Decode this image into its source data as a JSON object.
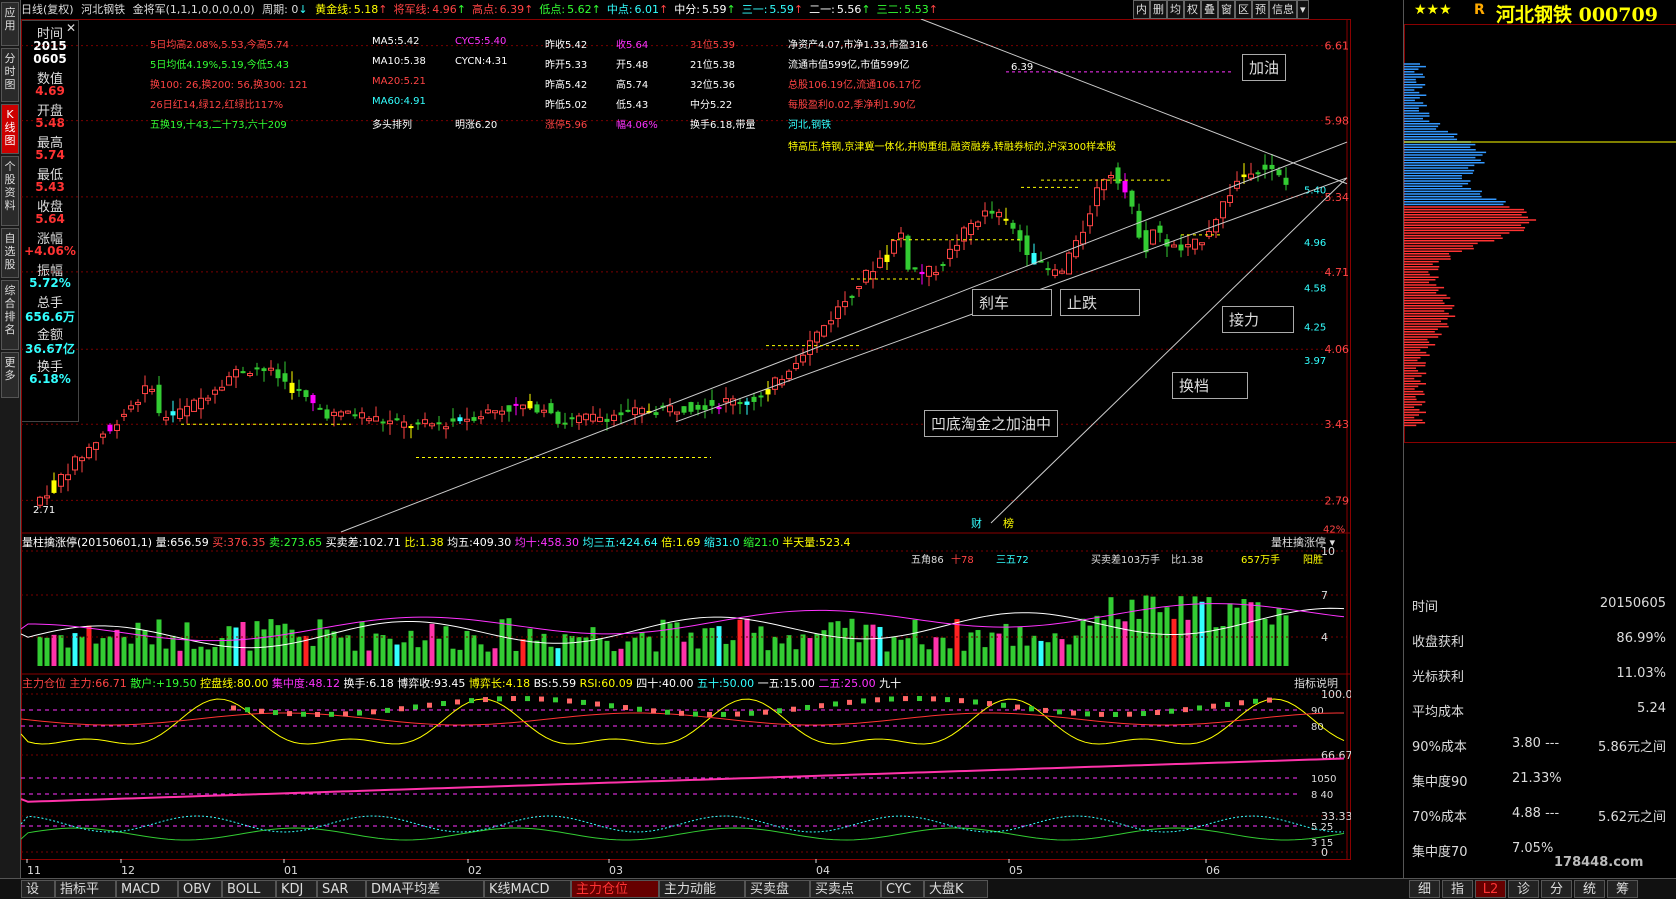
{
  "left_nav": [
    "应用",
    "分时图",
    "K线图",
    "个股资料",
    "自选股",
    "综合排名",
    "更多"
  ],
  "top_bar": {
    "mode": "日线(复权)",
    "stock": "河北钢铁",
    "indicator": "金将军(1,1,1,0,0,0,0,0)",
    "period": "周期: 0",
    "items": [
      {
        "label": "黄金线:",
        "value": "5.18",
        "color": "#ffff00"
      },
      {
        "label": "将军线:",
        "value": "4.96",
        "color": "#ff4444"
      },
      {
        "label": "高点:",
        "value": "6.39",
        "color": "#ff4444"
      },
      {
        "label": "低点:",
        "value": "5.62",
        "color": "#33ff33"
      },
      {
        "label": "中点:",
        "value": "6.01",
        "color": "#33ffff"
      },
      {
        "label": "中分:",
        "value": "5.59",
        "color": "#ffffff"
      },
      {
        "label": "三一:",
        "value": "5.59",
        "color": "#33ffff"
      },
      {
        "label": "二一:",
        "value": "5.56",
        "color": "#ffffff"
      },
      {
        "label": "三二:",
        "value": "5.53",
        "color": "#33ff33"
      }
    ]
  },
  "toolbar": [
    "内",
    "删",
    "均",
    "权",
    "叠",
    "窗",
    "区",
    "预",
    "信息"
  ],
  "info_panel": [
    {
      "label": "时间",
      "value": "2015\n0605",
      "color": "#ffffff"
    },
    {
      "label": "数值",
      "value": "4.69",
      "color": "#ff3333"
    },
    {
      "label": "开盘",
      "value": "5.48",
      "color": "#ff3333"
    },
    {
      "label": "最高",
      "value": "5.74",
      "color": "#ff3333"
    },
    {
      "label": "最低",
      "value": "5.43",
      "color": "#ff3333"
    },
    {
      "label": "收盘",
      "value": "5.64",
      "color": "#ff3333"
    },
    {
      "label": "涨幅",
      "value": "+4.06%",
      "color": "#ff3333"
    },
    {
      "label": "振幅",
      "value": "5.72%",
      "color": "#33ffff"
    },
    {
      "label": "总手",
      "value": "656.6万",
      "color": "#33ffff"
    },
    {
      "label": "金额",
      "value": "36.67亿",
      "color": "#33ffff"
    },
    {
      "label": "换手",
      "value": "6.18%",
      "color": "#33ffff"
    }
  ],
  "stock_info": [
    [
      "5日均高2.08%,5.53,今高5.74",
      "MA5:5.42",
      "CYC5:5.40",
      "昨收5.42",
      "收5.64",
      "31位5.39",
      "净资产4.07,市净1.33,市盈316"
    ],
    [
      "5日均低4.19%,5.19,今低5.43",
      "MA10:5.38",
      "CYCN:4.31",
      "昨开5.33",
      "开5.48",
      "21位5.38",
      "流通市值599亿,市值599亿"
    ],
    [
      "换100: 26,换200: 56,换300: 121",
      "MA20:5.21",
      "",
      "昨高5.42",
      "高5.74",
      "32位5.36",
      "总股106.19亿,流通106.17亿"
    ],
    [
      "26日红14,绿12,红绿比117%",
      "MA60:4.91",
      "",
      "昨低5.02",
      "低5.43",
      "中分5.22",
      "每股盈利0.02,季净利1.90亿"
    ],
    [
      "五换19,十43,二十73,六十209",
      "多头排列",
      "明涨6.20",
      "涨停5.96",
      "幅4.06%",
      "换手6.18,带量",
      "河北,钢铁"
    ]
  ],
  "concept_line": "特高压,特钢,京津冀一体化,并购重组,融资融券,转融券标的,沪深300样本股",
  "price_axis": [
    "6.61",
    "5.98",
    "5.34",
    "4.71",
    "4.06",
    "3.43",
    "2.79"
  ],
  "price_axis_inner": [
    "5.40",
    "4.96",
    "4.58",
    "4.25",
    "3.97"
  ],
  "pct_label": "42%",
  "price_marks": {
    "high_label": "6.39",
    "low_label": "2.71"
  },
  "annotations": [
    "加油",
    "刹车",
    "止跌",
    "接力",
    "换档",
    "凹底淘金之加油中"
  ],
  "markers": [
    "财",
    "榜"
  ],
  "volume_header": {
    "title": "量柱擒涨停(20150601,1)",
    "items": [
      {
        "label": "量:",
        "value": "656.59",
        "color": "#ffffff"
      },
      {
        "label": "买:",
        "value": "376.35",
        "color": "#ff4444"
      },
      {
        "label": "卖:",
        "value": "273.65",
        "color": "#33ff33"
      },
      {
        "label": "买卖差:",
        "value": "102.71",
        "color": "#ffffff"
      },
      {
        "label": "比:",
        "value": "1.38",
        "color": "#ffff00"
      },
      {
        "label": "均五:",
        "value": "409.30",
        "color": "#ffffff"
      },
      {
        "label": "均十:",
        "value": "458.30",
        "color": "#ff33ff"
      },
      {
        "label": "均三五:",
        "value": "424.64",
        "color": "#33ffff"
      },
      {
        "label": "倍:",
        "value": "1.69",
        "color": "#ffff00"
      },
      {
        "label": "缩31:",
        "value": "0",
        "color": "#33ffff"
      },
      {
        "label": "缩21:",
        "value": "0",
        "color": "#33ff33"
      },
      {
        "label": "半天量:",
        "value": "523.4",
        "color": "#ffff00"
      }
    ],
    "dropdown": "量柱擒涨停",
    "tags": [
      "五角86",
      "十78",
      "三五72",
      "买卖差103万手",
      "比1.38",
      "657万手",
      "阳胜"
    ],
    "axis": [
      "10",
      "7",
      "4"
    ]
  },
  "lower_header": {
    "title": "主力仓位",
    "items": [
      {
        "label": "主力:",
        "value": "66.71",
        "color": "#ff4444"
      },
      {
        "label": "散户:",
        "value": "+19.50",
        "color": "#33ff33"
      },
      {
        "label": "控盘线:",
        "value": "80.00",
        "color": "#ffff00"
      },
      {
        "label": "集中度:",
        "value": "48.12",
        "color": "#ff33ff"
      },
      {
        "label": "换手:",
        "value": "6.18",
        "color": "#ffffff"
      },
      {
        "label": "博弈收:",
        "value": "93.45",
        "color": "#ffffff"
      },
      {
        "label": "博弈长:",
        "value": "4.18",
        "color": "#ffff00"
      },
      {
        "label": "BS:",
        "value": "5.59",
        "color": "#ffffff"
      },
      {
        "label": "RSI:",
        "value": "60.09",
        "color": "#ffff00"
      },
      {
        "label": "四十:",
        "value": "40.00",
        "color": "#ffffff"
      },
      {
        "label": "五十:",
        "value": "50.00",
        "color": "#33ffff"
      },
      {
        "label": "一五:",
        "value": "15.00",
        "color": "#ffffff"
      },
      {
        "label": "二五:",
        "value": "25.00",
        "color": "#ff33ff"
      },
      {
        "label": "九十",
        "value": "",
        "color": "#ffffff"
      }
    ],
    "button": "指标说明",
    "axis": [
      "100.00",
      "66.67",
      "33.33",
      "0"
    ],
    "inner_axis": [
      "90",
      "80",
      "1050",
      "8 40",
      "5 25",
      "3 15"
    ]
  },
  "x_axis": [
    "11",
    "12",
    "01",
    "02",
    "03",
    "04",
    "05",
    "06"
  ],
  "right_panel": {
    "stars": "★★★",
    "badge": "R",
    "name": "河北钢铁 000709",
    "rows": [
      {
        "label": "时间",
        "mid": "",
        "value": "20150605"
      },
      {
        "label": "收盘获利",
        "mid": "",
        "value": "86.99%"
      },
      {
        "label": "光标获利",
        "mid": "",
        "value": "11.03%"
      },
      {
        "label": "平均成本",
        "mid": "",
        "value": "5.24"
      },
      {
        "label": "90%成本",
        "mid": "3.80 ---",
        "value": "5.86元之间"
      },
      {
        "label": "集中度90",
        "mid": "21.33%",
        "value": ""
      },
      {
        "label": "70%成本",
        "mid": "4.88 ---",
        "value": "5.62元之间"
      },
      {
        "label": "集中度70",
        "mid": "7.05%",
        "value": ""
      }
    ],
    "watermark": "178448.com"
  },
  "bottom_tabs": [
    "设置",
    "指标平台",
    "MACD",
    "OBV",
    "BOLL",
    "KDJ",
    "SAR",
    "DMA平均差",
    "K线MACD",
    "主力仓位",
    "主力动能",
    "买卖盘",
    "买卖点",
    "CYC",
    "大盘K"
  ],
  "right_tabs": [
    "细",
    "指",
    "L2",
    "诊",
    "分",
    "统",
    "筹"
  ],
  "colors": {
    "up": "#ff3333",
    "down": "#33ff33",
    "yellow": "#ffff00",
    "magenta": "#ff33ff",
    "cyan": "#33ffff",
    "grid": "#7a0000"
  }
}
